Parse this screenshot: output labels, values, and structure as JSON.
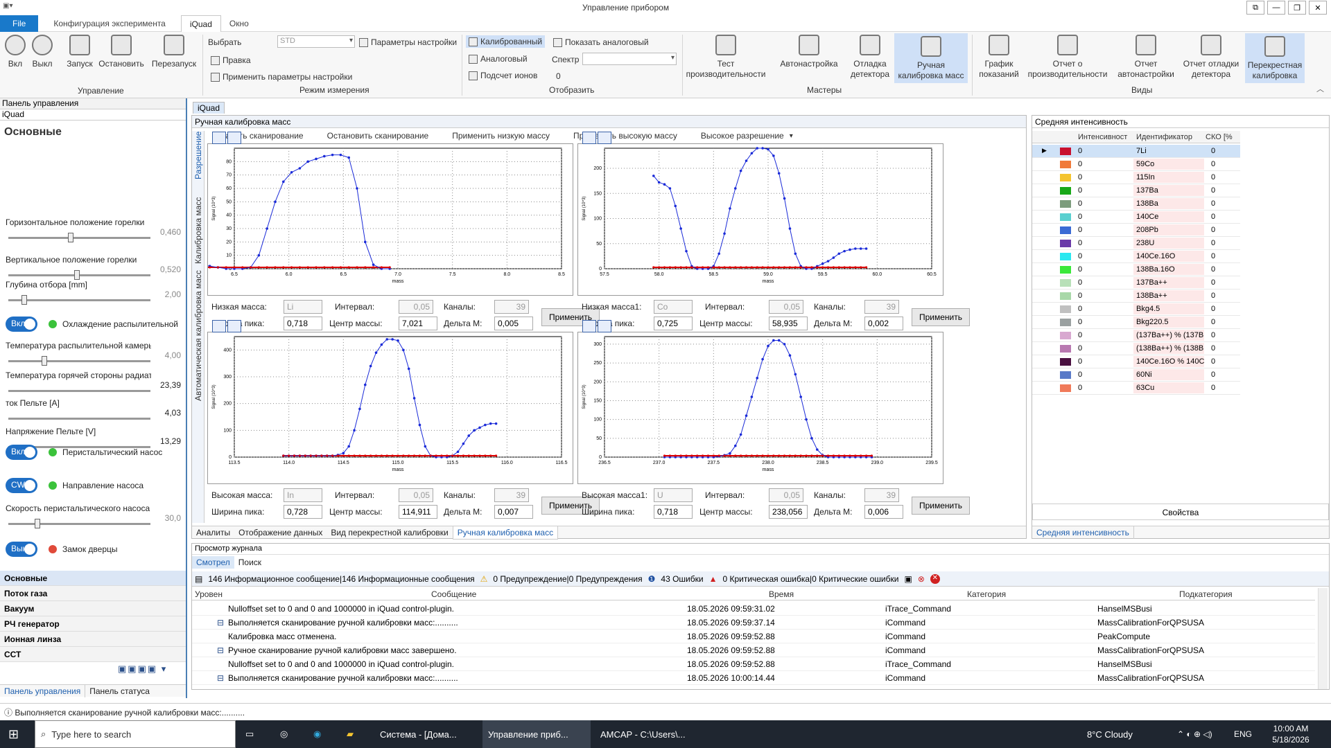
{
  "window": {
    "title": "Управление прибором"
  },
  "menu": {
    "file": "File",
    "config": "Конфигурация эксперимента",
    "iquad": "iQuad",
    "window": "Окно"
  },
  "ribbon": {
    "on": "Вкл",
    "off": "Выкл",
    "start": "Запуск",
    "stop": "Остановить",
    "restart": "Перезапуск",
    "group_control": "Управление",
    "select_label": "Выбрать",
    "select_value": "STD",
    "settings_params": "Параметры настройки",
    "edit": "Правка",
    "apply_settings": "Применить параметры настройки",
    "group_mode": "Режим измерения",
    "calibrated": "Калиброванный",
    "analog": "Аналоговый",
    "ion_count": "Подсчет ионов",
    "show_analog": "Показать аналоговый",
    "spectrum_label": "Спектр",
    "spectrum_value": "0",
    "group_show": "Отобразить",
    "perf_test": "Тест производительности",
    "autotune": "Автонастройка",
    "det_debug": "Отладка детектора",
    "manual_cal": "Ручная калибровка масс",
    "group_wizards": "Мастеры",
    "readings_chart": "График показаний",
    "perf_report": "Отчет о производительности",
    "autotune_report": "Отчет автонастройки",
    "det_debug_report": "Отчет отладки детектора",
    "cross_cal": "Перекрестная калибровка",
    "group_views": "Виды"
  },
  "left": {
    "panel_title": "Панель управления",
    "device": "iQuad",
    "section": "Основные",
    "sliders": [
      {
        "label": "Горизонтальное положение горелки",
        "value": "0,460",
        "level": 0.45
      },
      {
        "label": "Вертикальное положение горелки",
        "value": "0,520",
        "level": 0.5
      },
      {
        "label": "Глубина отбора [mm]",
        "value": "2,00",
        "level": 0.1
      },
      {
        "label": "Температура распылительной камеры",
        "value": "4,00",
        "level": 0.25
      },
      {
        "label": "Температура горячей стороны радиатора",
        "value": "23,39",
        "level": 0
      },
      {
        "label": "ток Пельте [A]",
        "value": "4,03",
        "level": 0
      },
      {
        "label": "Напряжение Пельте [V]",
        "value": "13,29",
        "level": 0
      },
      {
        "label": "Скорость перистальтического насоса",
        "value": "30,0",
        "level": 0.2
      }
    ],
    "toggles": [
      {
        "state": "Вкл",
        "label": "Охлаждение распылительной"
      },
      {
        "state": "Вкл",
        "label": "Перистальтический насос"
      },
      {
        "state": "CW",
        "label": "Направление насоса"
      },
      {
        "state": "Выкл",
        "label": "Замок дверцы"
      }
    ],
    "nav": [
      "Основные",
      "Поток газа",
      "Вакуум",
      "РЧ генератор",
      "Ионная линза",
      "ССТ"
    ],
    "bottom_tabs": [
      "Панель управления",
      "Панель статуса"
    ]
  },
  "center": {
    "doc_tab": "iQuad",
    "title": "Ручная калибровка масс",
    "side_tabs": [
      "Разрешение",
      "Калибровка масс",
      "Автоматическая калибровка масс"
    ],
    "actions": [
      "Начать сканирование",
      "Остановить сканирование",
      "Применить низкую массу",
      "Применить высокую массу",
      "Высокое разрешение"
    ],
    "panels": [
      {
        "mass_label": "Низкая масса:",
        "mass": "Li",
        "interval_label": "Интервал:",
        "interval": "0,05",
        "channels_label": "Каналы:",
        "channels": "39",
        "width_label": "Ширина пика:",
        "width": "0,718",
        "center_label": "Центр массы:",
        "center": "7,021",
        "delta_label": "Дельта М:",
        "delta": "0,005",
        "apply": "Применить"
      },
      {
        "mass_label": "Низкая масса1:",
        "mass": "Co",
        "interval_label": "Интервал:",
        "interval": "0,05",
        "channels_label": "Каналы:",
        "channels": "39",
        "width_label": "Ширина пика:",
        "width": "0,725",
        "center_label": "Центр массы:",
        "center": "58,935",
        "delta_label": "Дельта М:",
        "delta": "0,002",
        "apply": "Применить"
      },
      {
        "mass_label": "Высокая масса:",
        "mass": "In",
        "interval_label": "Интервал:",
        "interval": "0,05",
        "channels_label": "Каналы:",
        "channels": "39",
        "width_label": "Ширина пика:",
        "width": "0,728",
        "center_label": "Центр массы:",
        "center": "114,911",
        "delta_label": "Дельта М:",
        "delta": "0,007",
        "apply": "Применить"
      },
      {
        "mass_label": "Высокая масса1:",
        "mass": "U",
        "interval_label": "Интервал:",
        "interval": "0,05",
        "channels_label": "Каналы:",
        "channels": "39",
        "width_label": "Ширина пика:",
        "width": "0,718",
        "center_label": "Центр массы:",
        "center": "238,056",
        "delta_label": "Дельта М:",
        "delta": "0,006",
        "apply": "Применить"
      }
    ],
    "bottom_tabs": [
      "Аналиты",
      "Отображение данных",
      "Вид перекрестной калибровки",
      "Ручная калибровка масс"
    ]
  },
  "chart_data": [
    {
      "type": "line",
      "xlabel": "mass",
      "ylabel": "Signal (10^3)",
      "xlim": [
        6.5,
        8.5
      ],
      "ylim": [
        0,
        90
      ],
      "xticks": [
        "6.5",
        "6.0",
        "6.5",
        "7.0",
        "7.5",
        "8.0",
        "8.5"
      ],
      "yticks": [
        "0",
        "10",
        "20",
        "30",
        "40",
        "50",
        "60",
        "70",
        "80"
      ],
      "x": [
        6.05,
        6.1,
        6.15,
        6.2,
        6.25,
        6.3,
        6.35,
        6.4,
        6.45,
        6.5,
        6.55,
        6.6,
        6.65,
        6.7,
        6.75,
        6.8,
        6.85,
        6.9,
        6.95,
        7.0,
        7.05,
        7.1,
        7.15,
        7.2,
        7.25,
        7.3,
        7.35,
        7.4,
        7.45
      ],
      "y": [
        7,
        7,
        7,
        6,
        5,
        3,
        2,
        1,
        0,
        0,
        0,
        1,
        10,
        30,
        50,
        65,
        72,
        75,
        80,
        82,
        84,
        85,
        85,
        83,
        60,
        20,
        3,
        0,
        0
      ]
    },
    {
      "type": "line",
      "xlabel": "mass",
      "ylabel": "Signal (10^3)",
      "xlim": [
        57.5,
        60.5
      ],
      "ylim": [
        0,
        240
      ],
      "xticks": [
        "57.5",
        "58.0",
        "58.5",
        "59.0",
        "59.5",
        "60.0",
        "60.5"
      ],
      "yticks": [
        "0",
        "50",
        "100",
        "150",
        "200"
      ],
      "x": [
        57.95,
        58.0,
        58.05,
        58.1,
        58.15,
        58.2,
        58.25,
        58.3,
        58.35,
        58.4,
        58.45,
        58.5,
        58.55,
        58.6,
        58.65,
        58.7,
        58.75,
        58.8,
        58.85,
        58.9,
        58.95,
        59.0,
        59.05,
        59.1,
        59.15,
        59.2,
        59.25,
        59.3,
        59.35,
        59.4,
        59.45,
        59.5,
        59.55,
        59.6,
        59.65,
        59.7,
        59.75,
        59.8,
        59.85,
        59.9
      ],
      "y": [
        185,
        172,
        168,
        160,
        125,
        80,
        35,
        5,
        0,
        0,
        0,
        5,
        30,
        70,
        120,
        160,
        195,
        215,
        230,
        240,
        240,
        238,
        225,
        190,
        140,
        80,
        30,
        5,
        0,
        0,
        5,
        10,
        15,
        22,
        30,
        35,
        38,
        40,
        40,
        40
      ]
    },
    {
      "type": "line",
      "xlabel": "mass",
      "ylabel": "Signal (10^3)",
      "xlim": [
        113.5,
        116.5
      ],
      "ylim": [
        0,
        450
      ],
      "xticks": [
        "113.5",
        "114.0",
        "114.5",
        "115.0",
        "115.5",
        "116.0",
        "116.5"
      ],
      "yticks": [
        "0",
        "100",
        "200",
        "300",
        "400"
      ],
      "x": [
        113.95,
        114.0,
        114.05,
        114.1,
        114.15,
        114.2,
        114.25,
        114.3,
        114.35,
        114.4,
        114.45,
        114.5,
        114.55,
        114.6,
        114.65,
        114.7,
        114.75,
        114.8,
        114.85,
        114.9,
        114.95,
        115.0,
        115.05,
        115.1,
        115.15,
        115.2,
        115.25,
        115.3,
        115.35,
        115.4,
        115.45,
        115.5,
        115.55,
        115.6,
        115.65,
        115.7,
        115.75,
        115.8,
        115.85,
        115.9
      ],
      "y": [
        5,
        5,
        5,
        5,
        5,
        5,
        5,
        5,
        5,
        5,
        8,
        15,
        40,
        100,
        180,
        270,
        340,
        390,
        420,
        440,
        440,
        435,
        400,
        330,
        220,
        120,
        40,
        5,
        0,
        0,
        0,
        5,
        20,
        50,
        80,
        100,
        110,
        120,
        125,
        125
      ]
    },
    {
      "type": "line",
      "xlabel": "mass",
      "ylabel": "Signal (10^3)",
      "xlim": [
        236.5,
        239.5
      ],
      "ylim": [
        0,
        320
      ],
      "xticks": [
        "236.5",
        "237.0",
        "237.5",
        "238.0",
        "238.5",
        "239.0",
        "239.5"
      ],
      "yticks": [
        "0",
        "50",
        "100",
        "150",
        "200",
        "250",
        "300"
      ],
      "x": [
        237.05,
        237.1,
        237.15,
        237.2,
        237.25,
        237.3,
        237.35,
        237.4,
        237.45,
        237.5,
        237.55,
        237.6,
        237.65,
        237.7,
        237.75,
        237.8,
        237.85,
        237.9,
        237.95,
        238.0,
        238.05,
        238.1,
        238.15,
        238.2,
        238.25,
        238.3,
        238.35,
        238.4,
        238.45,
        238.5,
        238.55,
        238.6,
        238.65,
        238.7,
        238.75,
        238.8,
        238.85,
        238.9,
        238.95
      ],
      "y": [
        0,
        0,
        0,
        0,
        0,
        0,
        0,
        0,
        0,
        0,
        2,
        5,
        10,
        30,
        60,
        110,
        160,
        210,
        260,
        295,
        310,
        310,
        300,
        270,
        220,
        160,
        100,
        50,
        20,
        5,
        0,
        0,
        0,
        0,
        0,
        0,
        0,
        0,
        0
      ]
    }
  ],
  "right": {
    "title": "Средняя интенсивность",
    "columns": [
      "Интенсивност",
      "Идентификатор",
      "СКО [%"
    ],
    "rows": [
      {
        "intensity": "0",
        "id": "7Li",
        "sko": "0",
        "color": "#c8102e"
      },
      {
        "intensity": "0",
        "id": "59Co",
        "sko": "0",
        "color": "#f07a3a"
      },
      {
        "intensity": "0",
        "id": "115In",
        "sko": "0",
        "color": "#f4c430"
      },
      {
        "intensity": "0",
        "id": "137Ba",
        "sko": "0",
        "color": "#18a818"
      },
      {
        "intensity": "0",
        "id": "138Ba",
        "sko": "0",
        "color": "#7c9c7c"
      },
      {
        "intensity": "0",
        "id": "140Ce",
        "sko": "0",
        "color": "#5ad0d0"
      },
      {
        "intensity": "0",
        "id": "208Pb",
        "sko": "0",
        "color": "#3a6ad4"
      },
      {
        "intensity": "0",
        "id": "238U",
        "sko": "0",
        "color": "#6a3aa8"
      },
      {
        "intensity": "0",
        "id": "140Ce.16O",
        "sko": "0",
        "color": "#2ae8f0"
      },
      {
        "intensity": "0",
        "id": "138Ba.16O",
        "sko": "0",
        "color": "#3ae83a"
      },
      {
        "intensity": "0",
        "id": "137Ba++",
        "sko": "0",
        "color": "#b8e0b8"
      },
      {
        "intensity": "0",
        "id": "138Ba++",
        "sko": "0",
        "color": "#a8d8a8"
      },
      {
        "intensity": "0",
        "id": "Bkg4.5",
        "sko": "0",
        "color": "#c0c0c0"
      },
      {
        "intensity": "0",
        "id": "Bkg220.5",
        "sko": "0",
        "color": "#9aa0a0"
      },
      {
        "intensity": "0",
        "id": "(137Ba++) % (137B",
        "sko": "0",
        "color": "#d8a8d0"
      },
      {
        "intensity": "0",
        "id": "(138Ba++) % (138B",
        "sko": "0",
        "color": "#b878b0"
      },
      {
        "intensity": "0",
        "id": "140Ce.16O % 140C",
        "sko": "0",
        "color": "#4a1040"
      },
      {
        "intensity": "0",
        "id": "60Ni",
        "sko": "0",
        "color": "#5a7ac8"
      },
      {
        "intensity": "0",
        "id": "63Cu",
        "sko": "0",
        "color": "#f07a5a"
      }
    ],
    "properties": "Свойства",
    "bottom_tab": "Средняя интенсивность"
  },
  "log": {
    "title": "Просмотр журнала",
    "tabs": [
      "Смотрел",
      "Поиск"
    ],
    "info": "146 Информационное сообщение|146 Информационные сообщения",
    "warn": "0 Предупреждение|0 Предупреждения",
    "err": "43 Ошибки",
    "crit": "0 Критическая ошибка|0 Критические ошибки",
    "columns": [
      "Уровен",
      "Сообщение",
      "Время",
      "Категория",
      "Подкатегория"
    ],
    "rows": [
      {
        "msg": "Nulloffset set to 0 and 0 and 1000000 in iQuad control-plugin.",
        "time": "18.05.2026 09:59:31.02",
        "cat": "iTrace_Command",
        "sub": "HanselMSBusi"
      },
      {
        "msg": "Выполняется сканирование ручной калибровки масс:..........",
        "time": "18.05.2026 09:59:37.14",
        "cat": "iCommand",
        "sub": "MassCalibrationForQPSUSA"
      },
      {
        "msg": "Калибровка масс отменена.",
        "time": "18.05.2026 09:59:52.88",
        "cat": "iCommand",
        "sub": "PeakCompute"
      },
      {
        "msg": "Ручное сканирование ручной калибровки масс завершено.",
        "time": "18.05.2026 09:59:52.88",
        "cat": "iCommand",
        "sub": "MassCalibrationForQPSUSA"
      },
      {
        "msg": "Nulloffset set to 0 and 0 and 1000000 in iQuad control-plugin.",
        "time": "18.05.2026 09:59:52.88",
        "cat": "iTrace_Command",
        "sub": "HanselMSBusi"
      },
      {
        "msg": "Выполняется сканирование ручной калибровки масс:..........",
        "time": "18.05.2026 10:00:14.44",
        "cat": "iCommand",
        "sub": "MassCalibrationForQPSUSA"
      }
    ]
  },
  "status": {
    "text": "Выполняется сканирование ручной калибровки масс:.........."
  },
  "taskbar": {
    "search": "Type here to search",
    "apps": [
      "Система - [Дома...",
      "Управление приб...",
      "AMCAP - C:\\Users\\..."
    ],
    "weather": "8°C Cloudy",
    "lang": "ENG",
    "time": "10:00 AM",
    "date": "5/18/2026"
  }
}
